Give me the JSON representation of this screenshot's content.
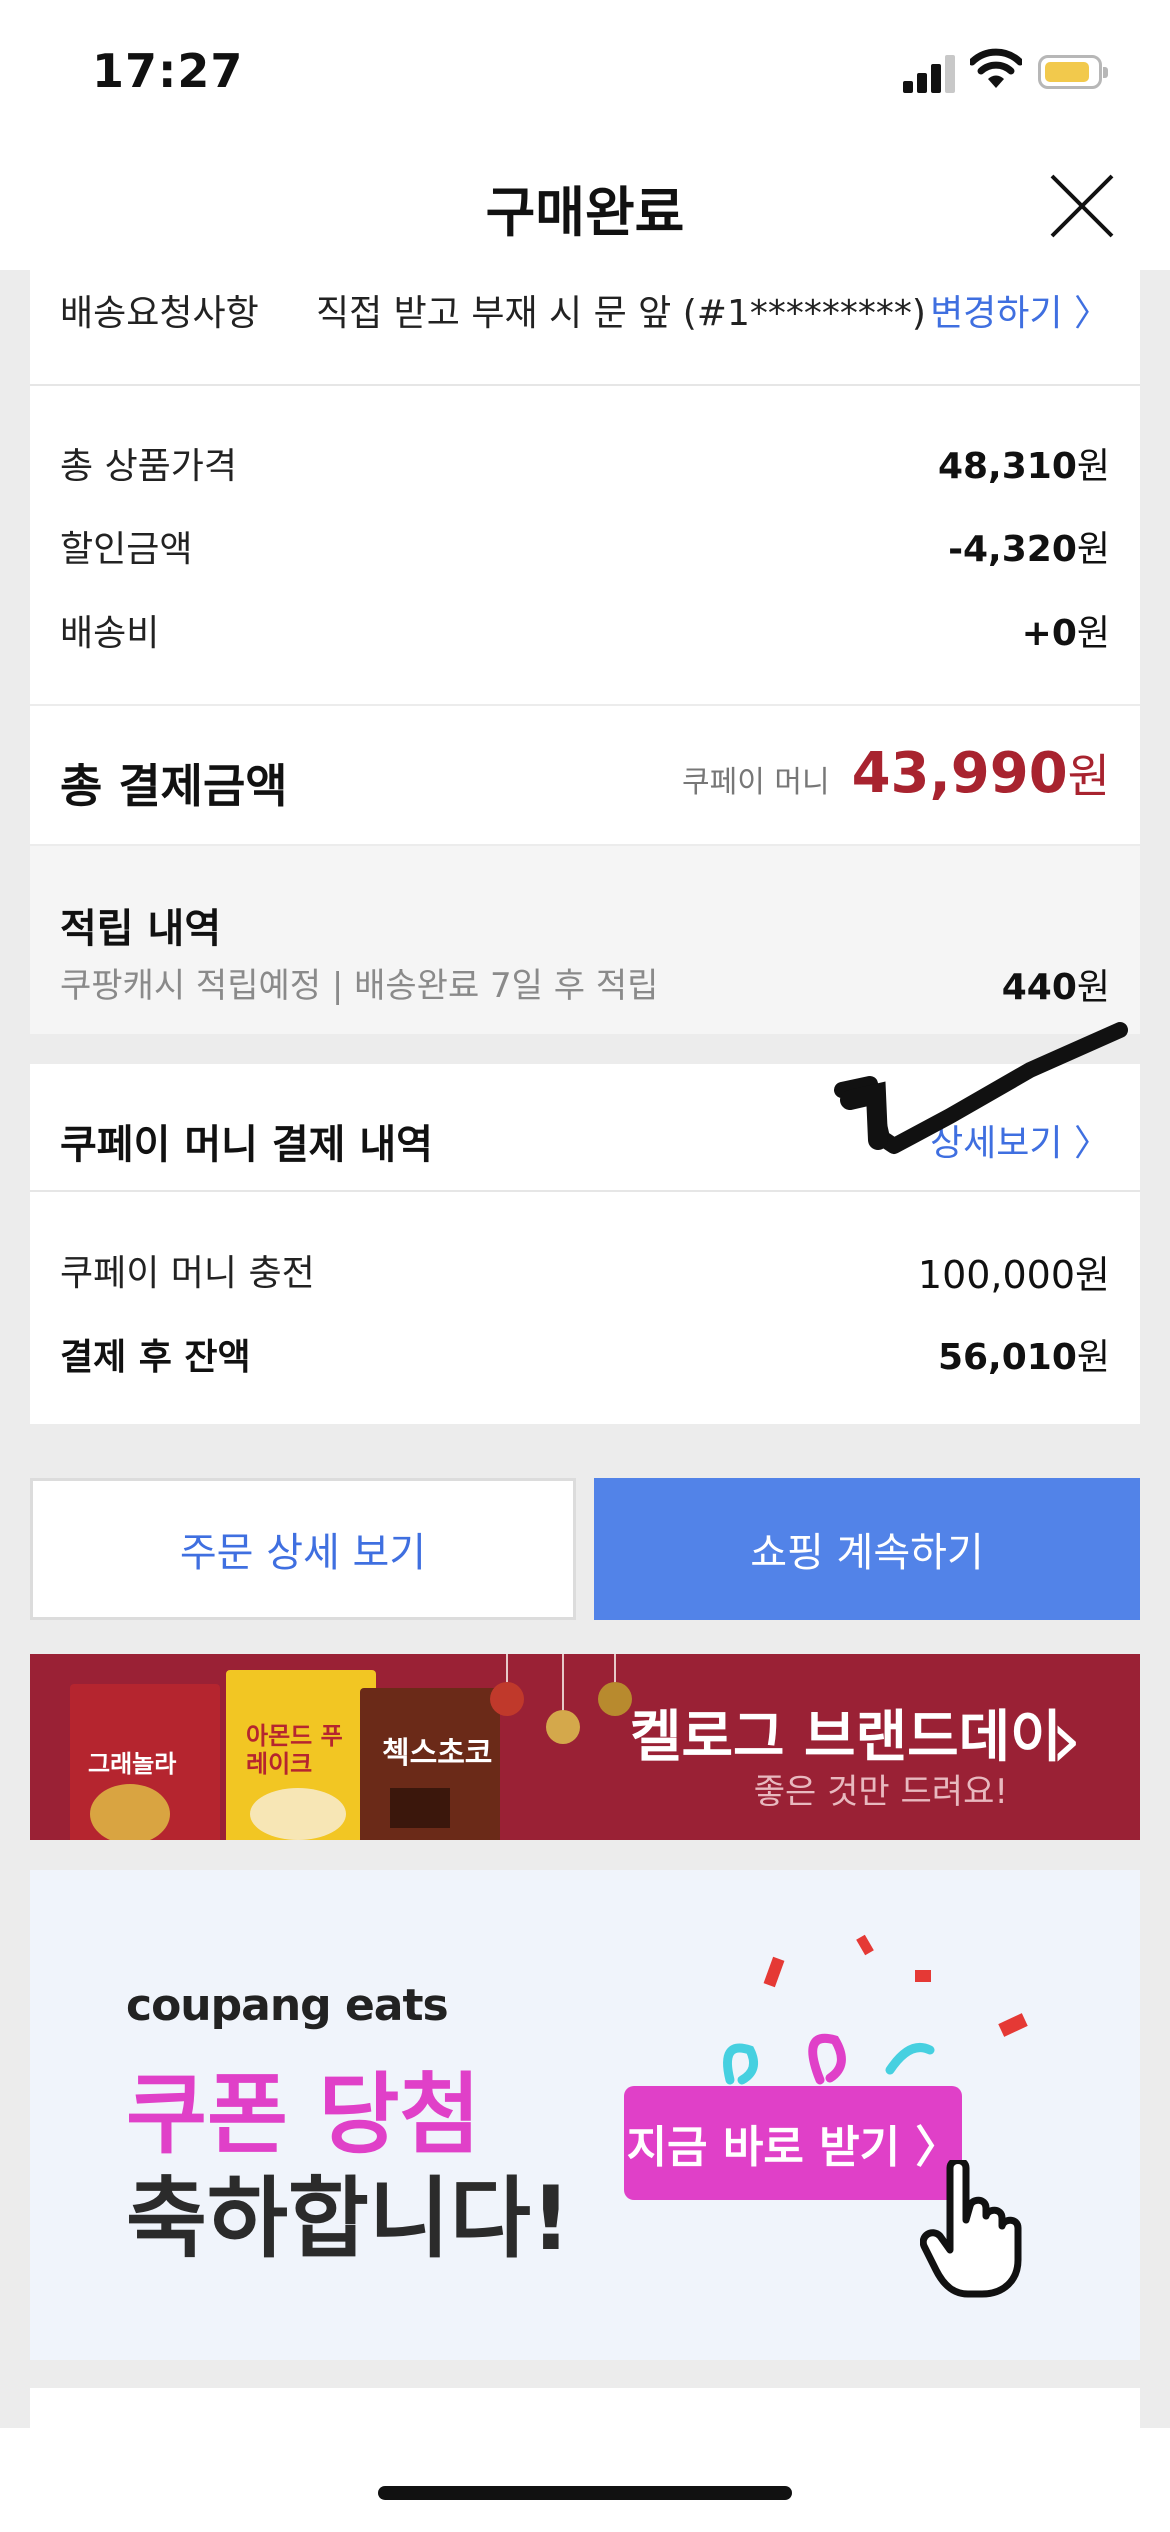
{
  "status_bar": {
    "time": "17:27"
  },
  "header": {
    "title": "구매완료"
  },
  "delivery": {
    "label": "배송요청사항",
    "value": "직접 받고 부재 시 문 앞 (#1*********)",
    "change_link": "변경하기 〉"
  },
  "summary": {
    "rows": [
      {
        "label": "총 상품가격",
        "amount": "48,310",
        "unit": "원"
      },
      {
        "label": "할인금액",
        "amount": "-4,320",
        "unit": "원"
      },
      {
        "label": "배송비",
        "amount": "+0",
        "unit": "원"
      }
    ]
  },
  "total": {
    "label": "총 결제금액",
    "method": "쿠페이 머니",
    "amount": "43,990",
    "unit": "원",
    "color": "#a8232f"
  },
  "reward": {
    "title": "적립 내역",
    "desc": "쿠팡캐시 적립예정 | 배송완료 7일 후 적립",
    "amount": "440",
    "unit": "원"
  },
  "coupay": {
    "title": "쿠페이 머니 결제 내역",
    "detail_link": "상세보기 〉",
    "rows": [
      {
        "label": "쿠페이 머니 충전",
        "amount": "100,000",
        "unit": "원"
      },
      {
        "label": "결제 후 잔액",
        "amount": "56,010",
        "unit": "원"
      }
    ]
  },
  "buttons": {
    "order_detail": "주문 상세 보기",
    "continue_shopping": "쇼핑 계속하기"
  },
  "kellogg_banner": {
    "title": "켈로그 브랜드데이",
    "subtitle": "좋은 것만 드려요!",
    "arrow": "›",
    "boxes": [
      "그래놀라",
      "아몬드 푸레이크",
      "첵스초코"
    ]
  },
  "eats_banner": {
    "brand": "coupang eats",
    "headline": "쿠폰 당첨",
    "subheadline": "축하합니다!",
    "cta": "지금 바로 받기 〉",
    "accent": "#e040c8"
  },
  "colors": {
    "link": "#3f6fe0",
    "primary_button": "#5283e8",
    "banner_red": "#9a2135"
  }
}
